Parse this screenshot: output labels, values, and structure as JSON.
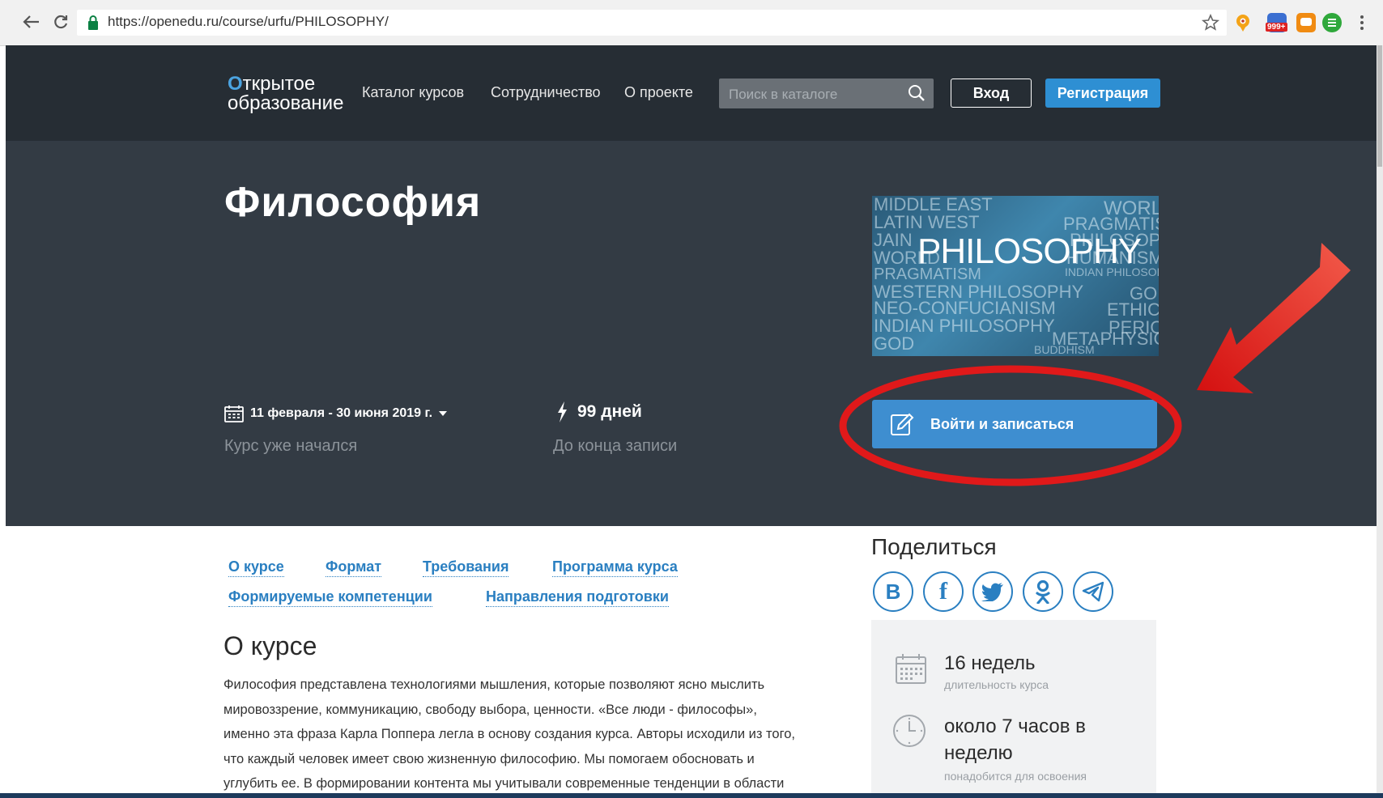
{
  "browser": {
    "url": "https://openedu.ru/course/urfu/PHILOSOPHY/",
    "badge_count": "999+"
  },
  "header": {
    "logo_line1": "ткрытое",
    "logo_o": "О",
    "logo_line2": "образование",
    "nav": [
      "Каталог курсов",
      "Сотрудничество",
      "О проекте"
    ],
    "search_placeholder": "Поиск в каталоге",
    "login_label": "Вход",
    "register_label": "Регистрация"
  },
  "hero": {
    "title": "Философия",
    "cover_title": "PHILOSOPHY",
    "cover_words": [
      "MIDDLE EAST",
      "WORLD",
      "LATIN WEST",
      "PRAGMATISM",
      "JAIN",
      "PHILOSOPHY",
      "WORLD",
      "HUMANISM",
      "PRAGMATISM",
      "INDIAN PHILOSOPHY",
      "WESTERN PHILOSOPHY",
      "GOD",
      "NEO-CONFUCIANISM",
      "ETHICS",
      "INDIAN PHILOSOPHY",
      "PERIOD",
      "GOD",
      "METAPHYSICS",
      "BUDDHISM"
    ],
    "dates": "11 февраля - 30 июня 2019 г.",
    "status": "Курс уже начался",
    "days_left": "99 дней",
    "days_caption": "До конца записи",
    "enroll_label": "Войти и записаться"
  },
  "tabs": [
    "О курсе",
    "Формат",
    "Требования",
    "Программа курса",
    "Формируемые компетенции",
    "Направления подготовки"
  ],
  "about": {
    "title": "О курсе",
    "lines": [
      "Философия представлена технологиями мышления, которые позволяют ясно мыслить",
      "мировоззрение, коммуникацию, свободу выбора, ценности. «Все люди - философы»,",
      "именно эта фраза Карла Поппера легла в основу создания курса. Авторы исходили из того,",
      "что каждый человек имеет свою жизненную философию. Мы помогаем обосновать и",
      "углубить ее. В формировании контента мы учитывали современные тенденции в области"
    ]
  },
  "share": {
    "title": "Поделиться",
    "networks": [
      "vk",
      "facebook",
      "twitter",
      "odnoklassniki",
      "telegram"
    ],
    "vk_letter": "B",
    "fb_letter": "f"
  },
  "info": {
    "duration_value": "16 недель",
    "duration_caption": "длительность курса",
    "effort_line1": "около 7 часов в",
    "effort_line2": "неделю",
    "effort_caption": "понадобится для освоения"
  },
  "colors": {
    "header_bg": "#262d34",
    "hero_bg": "#333b44",
    "accent": "#2e8fd3",
    "annotation": "#e0191a"
  }
}
